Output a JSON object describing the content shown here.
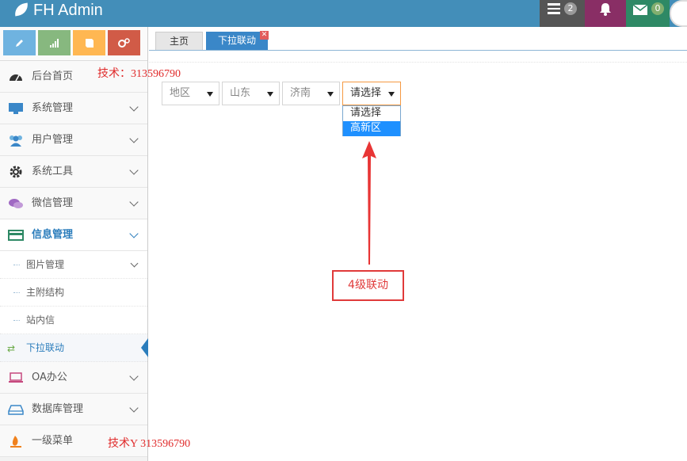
{
  "header": {
    "brand": "FH Admin",
    "tasks_badge": "2",
    "messages_badge": "0",
    "colors": {
      "navbar": "#438eb9",
      "tasks": "#555555",
      "notifications": "#892e65",
      "messages": "#2e8965"
    }
  },
  "shortcuts": [
    {
      "icon": "pencil-icon",
      "color": "#6fb3e0"
    },
    {
      "icon": "signal-icon",
      "color": "#87b87f"
    },
    {
      "icon": "book-icon",
      "color": "#ffb752"
    },
    {
      "icon": "cogs-icon",
      "color": "#d15b47"
    }
  ],
  "sidebar": {
    "items": [
      {
        "label": "后台首页",
        "icon": "dashboard-icon"
      },
      {
        "label": "系统管理",
        "icon": "desktop-icon"
      },
      {
        "label": "用户管理",
        "icon": "users-icon"
      },
      {
        "label": "系统工具",
        "icon": "cog-icon"
      },
      {
        "label": "微信管理",
        "icon": "comments-icon"
      },
      {
        "label": "信息管理",
        "icon": "credit-card-icon"
      }
    ],
    "subitems": [
      {
        "label": "图片管理"
      },
      {
        "label": "主附结构"
      },
      {
        "label": "站内信"
      },
      {
        "label": "下拉联动"
      }
    ],
    "items_after": [
      {
        "label": "OA办公",
        "icon": "laptop-icon"
      },
      {
        "label": "数据库管理",
        "icon": "hdd-icon"
      },
      {
        "label": "一级菜单",
        "icon": "fire-icon"
      }
    ]
  },
  "tabs": [
    {
      "label": "主页"
    },
    {
      "label": "下拉联动"
    }
  ],
  "form": {
    "level1": "地区",
    "level2": "山东",
    "level3": "济南",
    "level4": "请选择",
    "level4_options": [
      "请选择",
      "高新区"
    ]
  },
  "annotation": {
    "watermark1": "技术：313596790",
    "watermark2": "技术Y 313596790",
    "box_label": "4级联动"
  }
}
